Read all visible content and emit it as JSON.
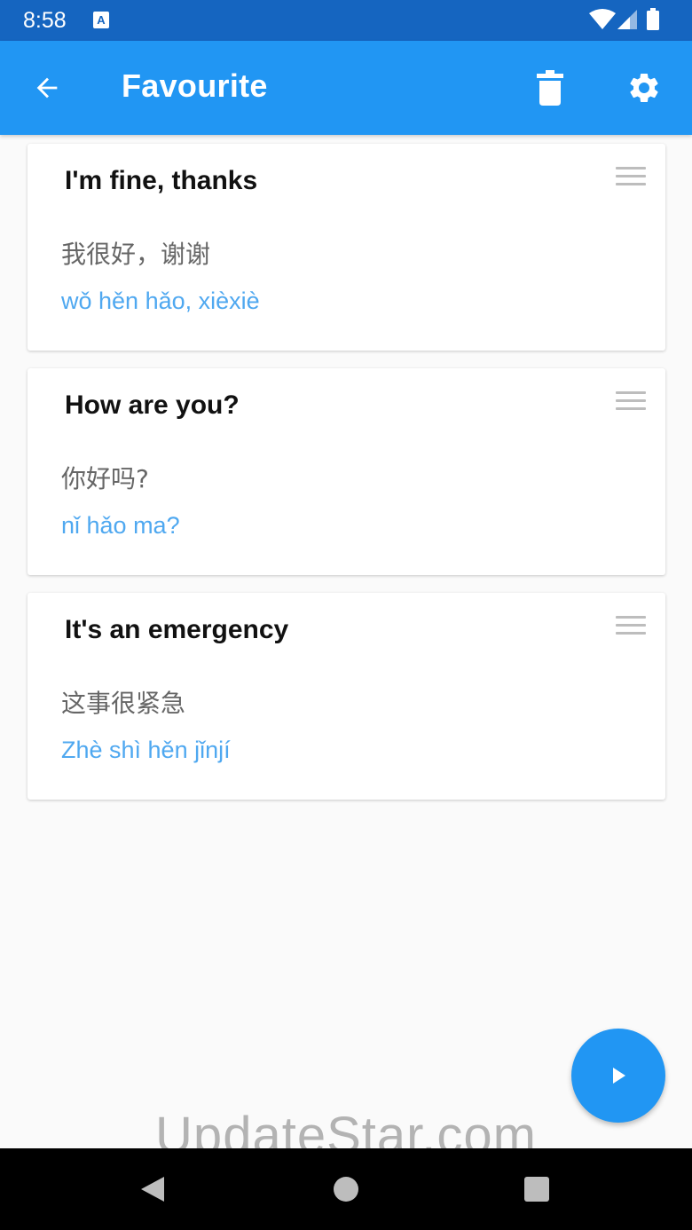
{
  "status_bar": {
    "time": "8:58",
    "a_icon_label": "A",
    "icons": [
      "a-notification-icon",
      "wifi-icon",
      "signal-icon",
      "battery-icon"
    ]
  },
  "app_bar": {
    "title": "Favourite",
    "icons": [
      "back-arrow-icon",
      "trash-icon",
      "gear-icon"
    ]
  },
  "cards": [
    {
      "english": "I'm fine, thanks",
      "chinese": "我很好，谢谢",
      "pinyin": "wǒ hěn hǎo, xièxiè"
    },
    {
      "english": "How are you?",
      "chinese": "你好吗?",
      "pinyin": "nǐ hǎo ma?"
    },
    {
      "english": "It's an emergency",
      "chinese": "这事很紧急",
      "pinyin": "Zhè shì hěn jǐnjí"
    }
  ],
  "fab": {
    "icon": "play-icon"
  },
  "watermark": "UpdateStar.com",
  "nav_bar": {
    "icons": [
      "nav-back-icon",
      "nav-home-icon",
      "nav-recents-icon"
    ]
  },
  "colors": {
    "status_bar": "#1565c0",
    "app_bar": "#2196f3",
    "pinyin": "#4fa8f0",
    "fab": "#2196f3"
  }
}
